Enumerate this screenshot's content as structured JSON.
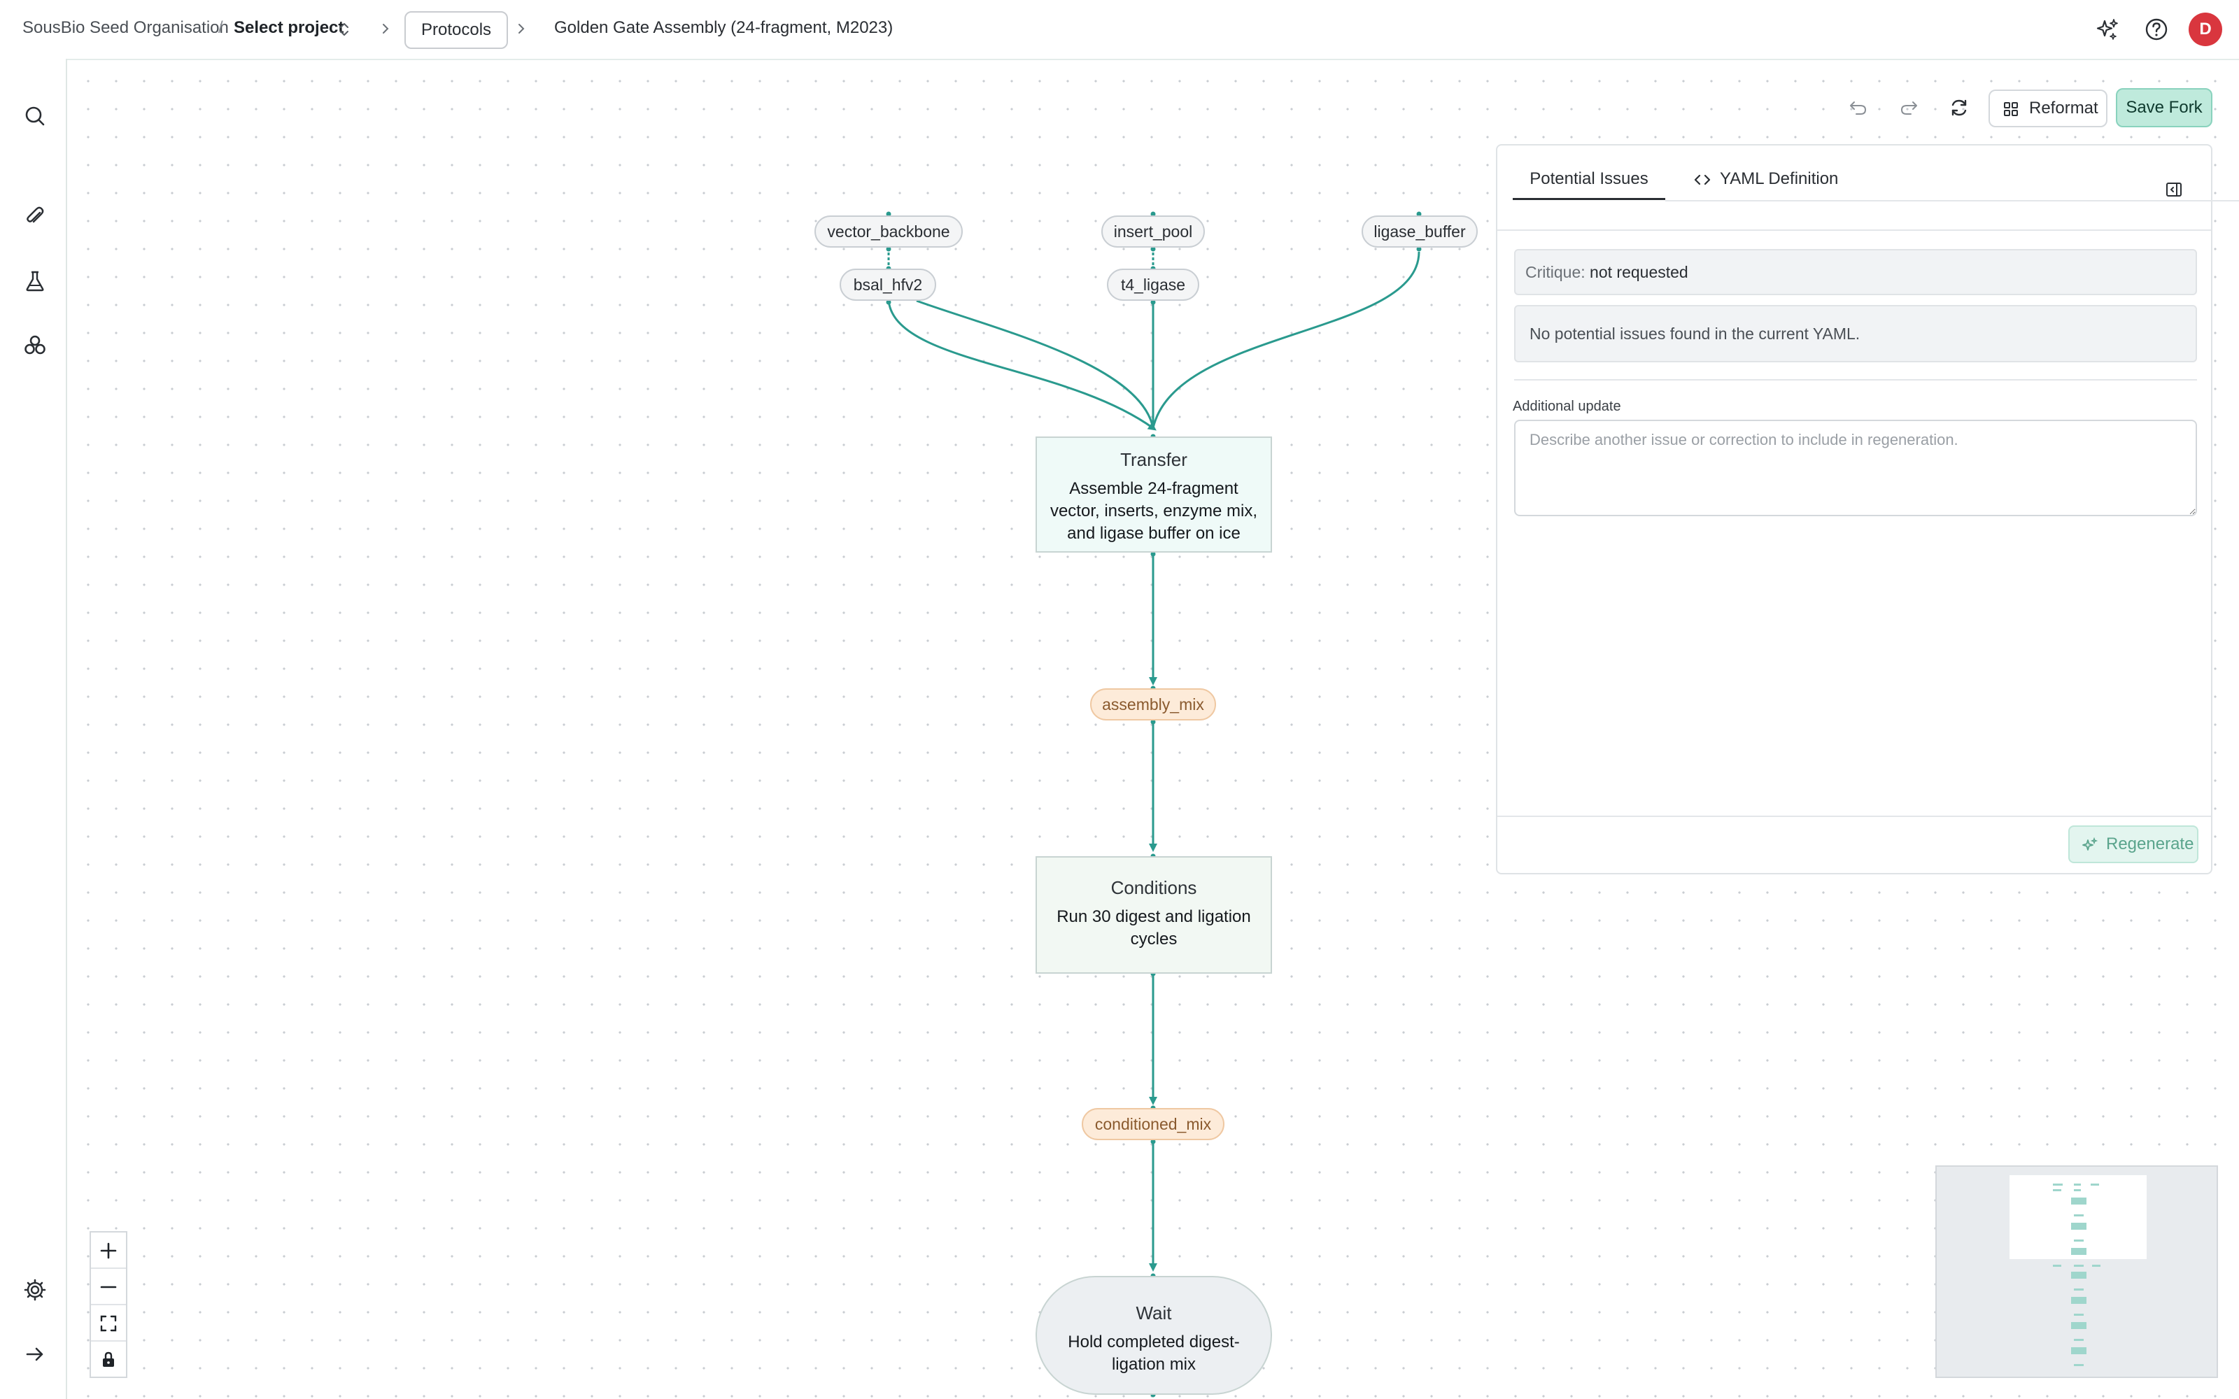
{
  "breadcrumb": {
    "organisation": "SousBio Seed Organisation",
    "separator": "/",
    "project": "Select project",
    "protocols": "Protocols",
    "title": "Golden Gate Assembly (24-fragment, M2023)"
  },
  "user": {
    "avatar_initial": "D"
  },
  "toolbar": {
    "reformat_label": "Reformat",
    "save_fork_label": "Save Fork"
  },
  "graph": {
    "inputs": [
      "vector_backbone",
      "insert_pool",
      "ligase_buffer",
      "bsal_hfv2",
      "t4_ligase"
    ],
    "nodes": [
      {
        "type": "Transfer",
        "description": "Assemble 24-fragment vector, inserts, enzyme mix, and ligase buffer on ice"
      },
      {
        "type": "Conditions",
        "description": "Run 30 digest and ligation cycles"
      },
      {
        "type": "Wait",
        "description": "Hold completed digest-ligation mix"
      }
    ],
    "outputs": [
      "assembly_mix",
      "conditioned_mix"
    ]
  },
  "panel": {
    "tabs": [
      "Potential Issues",
      "YAML Definition"
    ],
    "critique_label": "Critique:",
    "critique_value": "not requested",
    "no_issues_text": "No potential issues found in the current YAML.",
    "additional_update_label": "Additional update",
    "additional_update_placeholder": "Describe another issue or correction to include in regeneration.",
    "regenerate_label": "Regenerate"
  },
  "colors": {
    "edge": "#2a9a8e",
    "accent": "#bfeadc",
    "avatar": "#d9363e",
    "output_pill": "#fdebd9"
  }
}
